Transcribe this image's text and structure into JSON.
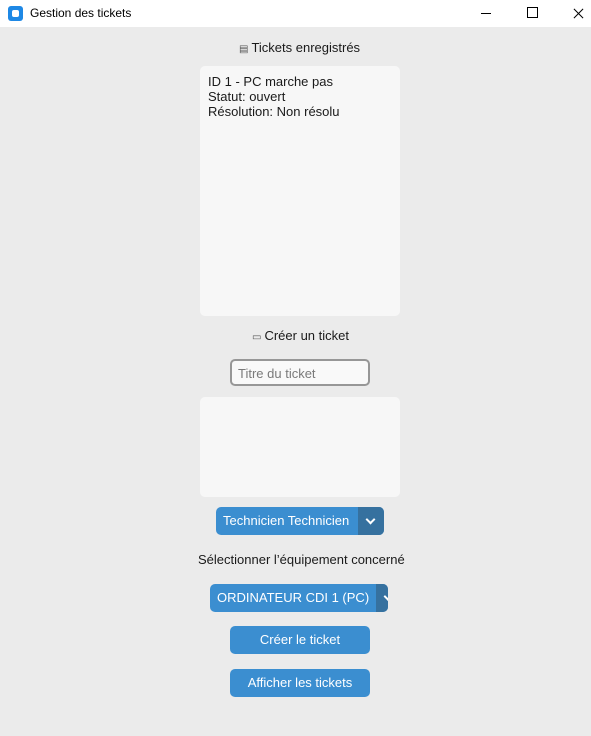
{
  "window": {
    "title": "Gestion des tickets"
  },
  "tickets_section": {
    "icon": "clipboard-icon",
    "heading": "Tickets enregistrés",
    "lines": [
      "ID 1 - PC marche pas",
      "Statut: ouvert",
      "Résolution: Non résolu"
    ]
  },
  "create_section": {
    "icon": "inbox-icon",
    "heading": "Créer un ticket",
    "title_placeholder": "Titre du ticket",
    "description": ""
  },
  "technician_select": {
    "value": "Technicien Technicien"
  },
  "equipment_label": "Sélectionner l’équipement concerné",
  "equipment_select": {
    "value": "ORDINATEUR CDI 1 (PC)"
  },
  "buttons": {
    "create": "Créer le ticket",
    "show": "Afficher les tickets"
  },
  "colors": {
    "accent": "#3b8ed0",
    "accent_dark": "#36719f",
    "background": "#ebebeb"
  }
}
